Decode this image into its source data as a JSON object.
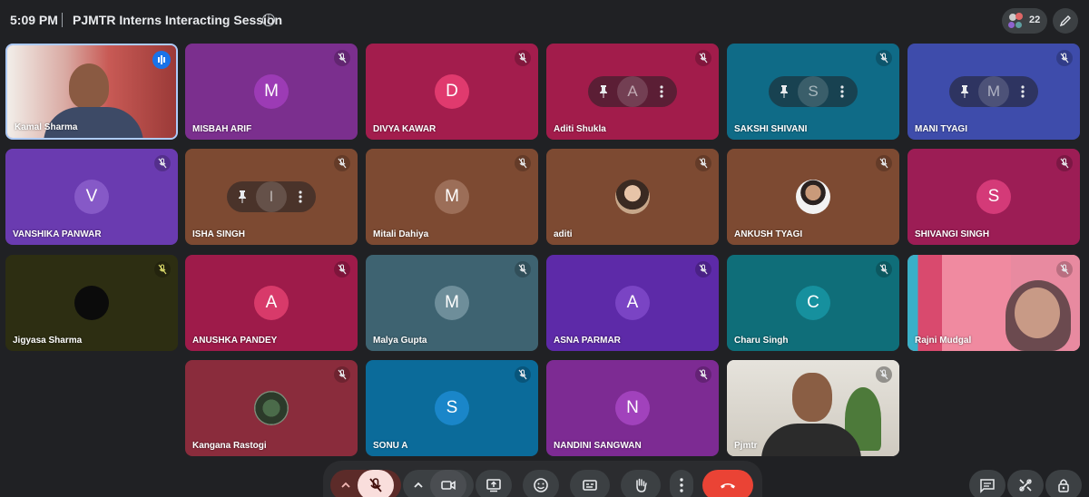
{
  "header": {
    "time": "5:09 PM",
    "meeting_title": "PJMTR Interns Interacting Session",
    "info_icon": "i",
    "participant_count": "22"
  },
  "colors": {
    "background": "#202124",
    "end_call": "#ea4335",
    "mic_off_bg": "#f9dedc"
  },
  "tiles": [
    {
      "name": "Kamal Sharma",
      "kind": "video",
      "speaking": true
    },
    {
      "name": "MISBAH ARIF",
      "initial": "M",
      "bg": "#7b2f8e",
      "avatar_bg": "#9c3bb5"
    },
    {
      "name": "DIVYA KAWAR",
      "initial": "D",
      "bg": "#a31d4d",
      "avatar_bg": "#e03a6e"
    },
    {
      "name": "Aditi Shukla",
      "initial": "A",
      "bg": "#a21c4b",
      "hover": true
    },
    {
      "name": "SAKSHI SHIVANI",
      "initial": "S",
      "bg": "#0f6b87",
      "hover": true
    },
    {
      "name": "MANI TYAGI",
      "initial": "M",
      "bg": "#3e4cab",
      "hover": true
    },
    {
      "name": "VANSHIKA PANWAR",
      "initial": "V",
      "bg": "#6a3bb0",
      "avatar_bg": "#8659c7"
    },
    {
      "name": "ISHA SINGH",
      "initial": "I",
      "bg": "#7d4a32",
      "hover": true
    },
    {
      "name": "Mitali Dahiya",
      "initial": "M",
      "bg": "#7d4a32",
      "avatar_bg": "#9c6e58"
    },
    {
      "name": "aditi",
      "kind": "photo",
      "bg": "#7d4a32"
    },
    {
      "name": "ANKUSH TYAGI",
      "kind": "photo",
      "bg": "#7d4a32"
    },
    {
      "name": "SHIVANGI SINGH",
      "initial": "S",
      "bg": "#9c1d55",
      "avatar_bg": "#d43a78"
    },
    {
      "name": "Jigyasa Sharma",
      "kind": "dark",
      "bg": "#2d2e12"
    },
    {
      "name": "ANUSHKA PANDEY",
      "initial": "A",
      "bg": "#9e1b4a",
      "avatar_bg": "#d83a6a"
    },
    {
      "name": "Malya Gupta",
      "initial": "M",
      "bg": "#3e6371",
      "avatar_bg": "#6e8e9a"
    },
    {
      "name": "ASNA PARMAR",
      "initial": "A",
      "bg": "#5d2aa8",
      "avatar_bg": "#7a44c4"
    },
    {
      "name": "Charu Singh",
      "initial": "C",
      "bg": "#0f6e79",
      "avatar_bg": "#16909e"
    },
    {
      "name": "Rajni Mudgal",
      "kind": "video2"
    },
    {
      "name": "Kangana Rastogi",
      "kind": "photo",
      "bg": "#8a2c3c"
    },
    {
      "name": "SONU A",
      "initial": "S",
      "bg": "#0b6b9a",
      "avatar_bg": "#1a86c9"
    },
    {
      "name": "NANDINI SANGWAN",
      "initial": "N",
      "bg": "#7d2b93",
      "avatar_bg": "#a142bc"
    },
    {
      "name": "Pjmtr",
      "kind": "video3"
    }
  ],
  "controls": {
    "mic": "mic-off",
    "camera": "camera",
    "present": "present-screen",
    "reactions": "emoji",
    "captions": "captions",
    "raise_hand": "raise-hand",
    "more": "more-options",
    "leave": "end-call"
  },
  "right_controls": [
    "chat",
    "activities",
    "host-controls"
  ]
}
